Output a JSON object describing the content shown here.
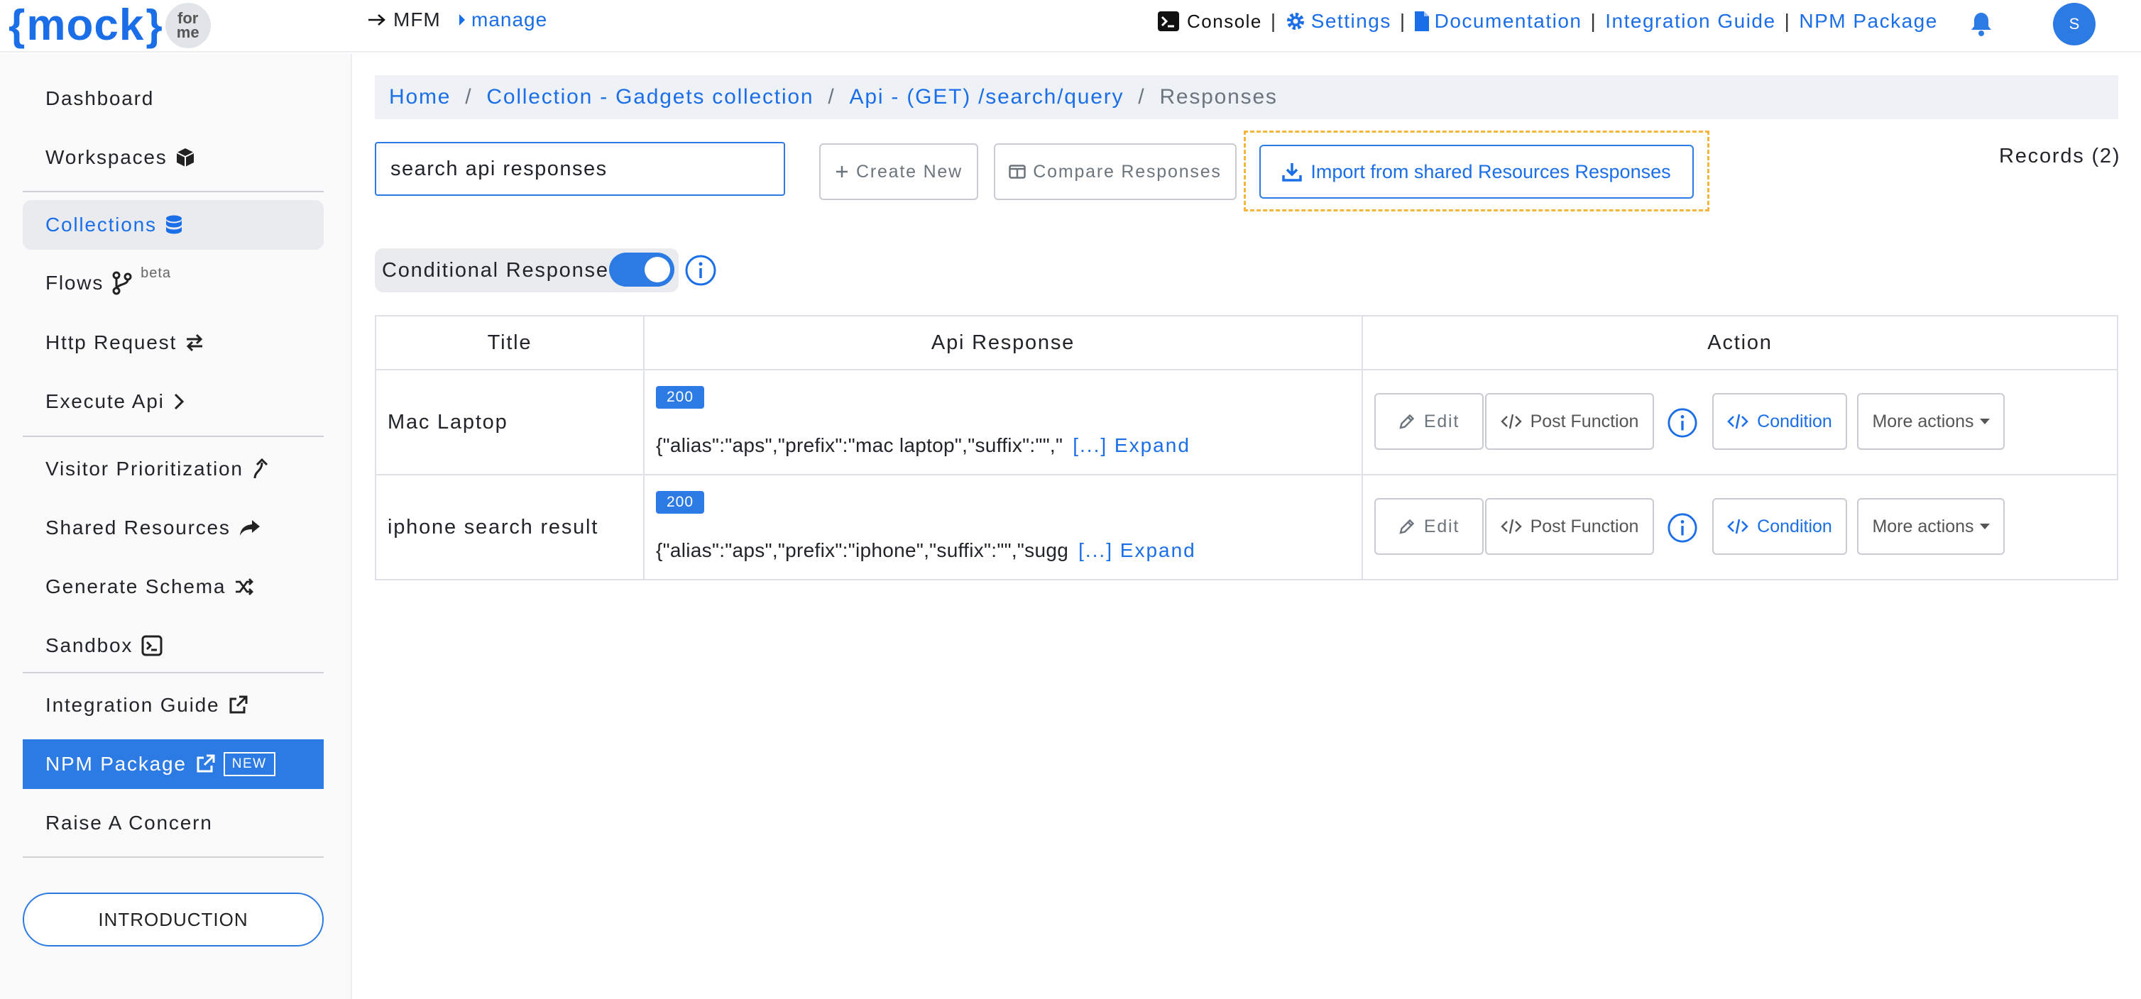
{
  "header": {
    "logo_text": "mock",
    "logo_badge_top": "for",
    "logo_badge_bottom": "me",
    "mfm_label": "MFM",
    "manage_label": "manage",
    "console_label": "Console",
    "settings_label": "Settings",
    "documentation_label": "Documentation",
    "integration_label": "Integration Guide",
    "npm_label": "NPM Package",
    "separator": "|",
    "avatar_initial": "S"
  },
  "sidebar": {
    "items": [
      {
        "label": "Dashboard"
      },
      {
        "label": "Workspaces"
      },
      {
        "label": "Collections"
      },
      {
        "label": "Flows",
        "sup": "beta"
      },
      {
        "label": "Http Request"
      },
      {
        "label": "Execute Api"
      },
      {
        "label": "Visitor Prioritization"
      },
      {
        "label": "Shared Resources"
      },
      {
        "label": "Generate Schema"
      },
      {
        "label": "Sandbox"
      },
      {
        "label": "Integration Guide"
      },
      {
        "label": "NPM Package",
        "badge": "NEW"
      },
      {
        "label": "Raise A Concern"
      }
    ],
    "intro_button": "INTRODUCTION"
  },
  "breadcrumb": {
    "home": "Home",
    "collection": "Collection - Gadgets collection",
    "api": "Api - (GET) /search/query",
    "current": "Responses",
    "separator": "/"
  },
  "toolbar": {
    "search_value": "search api responses",
    "create_new": "Create New",
    "compare": "Compare Responses",
    "import": "Import from shared Resources Responses",
    "records": "Records (2)"
  },
  "conditional": {
    "label": "Conditional Response",
    "enabled": true
  },
  "table": {
    "headers": [
      "Title",
      "Api Response",
      "Action"
    ],
    "rows": [
      {
        "title": "Mac Laptop",
        "status": "200",
        "response": "{\"alias\":\"aps\",\"prefix\":\"mac laptop\",\"suffix\":\"\",\"",
        "expand": "[...] Expand"
      },
      {
        "title": "iphone search result",
        "status": "200",
        "response": "{\"alias\":\"aps\",\"prefix\":\"iphone\",\"suffix\":\"\",\"sugg",
        "expand": "[...] Expand"
      }
    ],
    "actions": {
      "edit": "Edit",
      "post_function": "Post Function",
      "condition": "Condition",
      "more": "More actions"
    }
  },
  "colors": {
    "accent": "#2c7be5",
    "link": "#1a6ee8",
    "highlight_border": "#f5b73b"
  }
}
